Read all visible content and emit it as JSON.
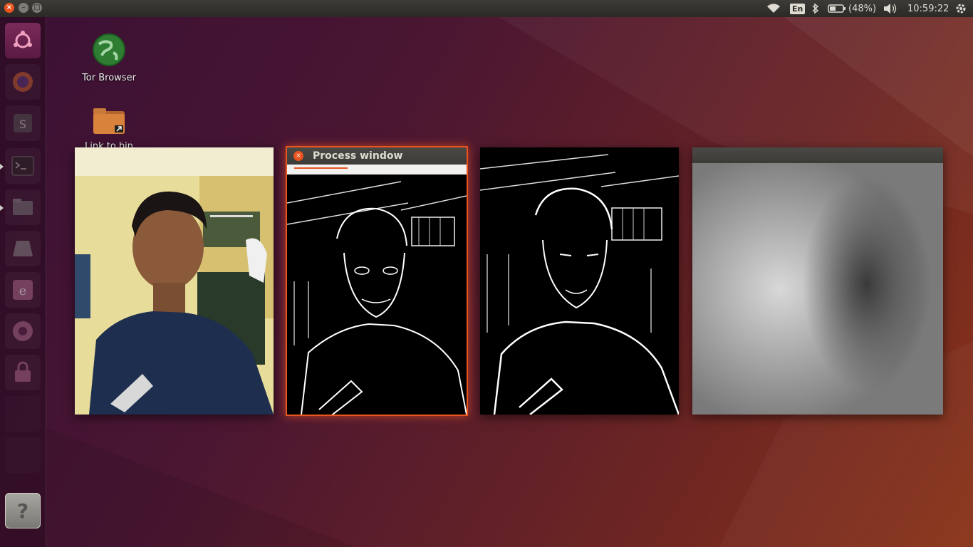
{
  "top_panel": {
    "keyboard_layout": "En",
    "battery": "(48%)",
    "clock": "10:59:22"
  },
  "desktop": {
    "icons": [
      {
        "label": "Tor Browser"
      },
      {
        "label": "Link to bin"
      }
    ]
  },
  "launcher": {
    "items": [
      {
        "name": "ubuntu-dash-icon"
      },
      {
        "name": "firefox-icon"
      },
      {
        "name": "sublime-text-icon"
      },
      {
        "name": "terminal-icon"
      },
      {
        "name": "files-icon"
      },
      {
        "name": "drive-icon"
      },
      {
        "name": "eclipse-icon"
      },
      {
        "name": "chrome-icon"
      },
      {
        "name": "lock-icon"
      },
      {
        "name": "help-icon",
        "glyph": "?"
      }
    ]
  },
  "windows": [
    {
      "kind": "original-photo"
    },
    {
      "kind": "process-window",
      "title": "Process window"
    },
    {
      "kind": "edge-image"
    },
    {
      "kind": "blur-window"
    }
  ],
  "colors": {
    "accent": "#e95420",
    "panel": "#3c3b37"
  }
}
